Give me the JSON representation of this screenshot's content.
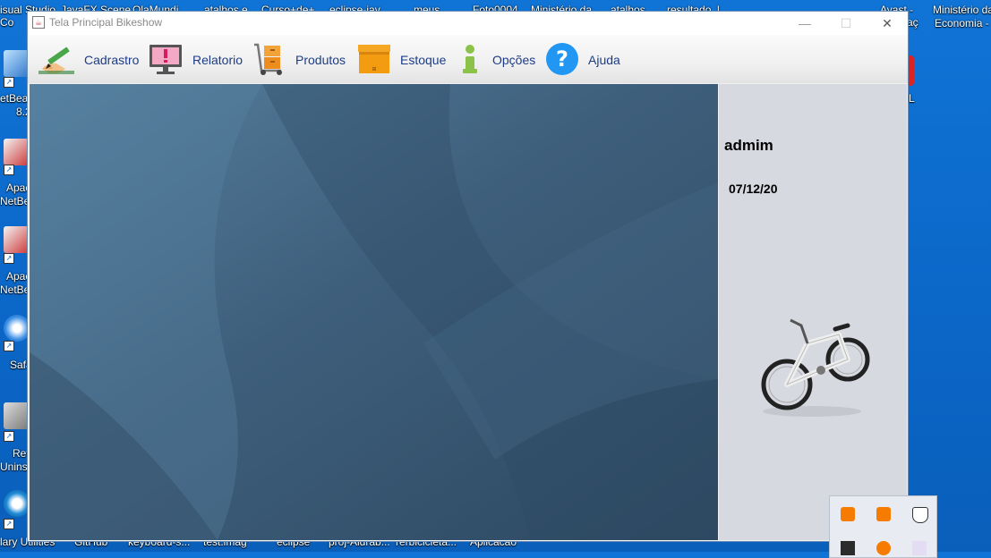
{
  "desktop": {
    "top_labels": [
      "isual Studio",
      "JavaFX Scene",
      "OlaMundi",
      "atalhos e",
      "Curso+de+",
      "eclipse-jav",
      "meus",
      "Foto0004",
      "Ministério da",
      "atalhos",
      "resultado_l",
      "Avast -",
      "Ministério da"
    ],
    "top_labels_line2": [
      "Co",
      "Economia -",
      "aç"
    ],
    "left_labels": [
      "etBea",
      "8.2",
      "Apac",
      "NetBea",
      "Apac",
      "NetBea",
      "Safa",
      "Rev",
      "Uninst"
    ],
    "bottom_labels": [
      "lary Utilities",
      "GitHub",
      "keyboard-s...",
      "test.imag",
      "eclipse",
      "proj-Aldrab...",
      "rerbicicleta...",
      "Aplicacao"
    ]
  },
  "window": {
    "title": "Tela Principal Bikeshow",
    "minimize_glyph": "—",
    "maximize_glyph": "☐",
    "close_glyph": "✕"
  },
  "toolbar": {
    "items": [
      {
        "label": "Cadrastro",
        "icon": "pencil-hand-icon"
      },
      {
        "label": "Relatorio",
        "icon": "monitor-alert-icon"
      },
      {
        "label": "Produtos",
        "icon": "hand-truck-boxes-icon"
      },
      {
        "label": "Estoque",
        "icon": "box-icon"
      },
      {
        "label": "Opções",
        "icon": "info-icon"
      },
      {
        "label": "Ajuda",
        "icon": "help-icon"
      }
    ]
  },
  "side_panel": {
    "user": "admim",
    "date": "07/12/20",
    "image": "bicycle-icon"
  },
  "colors": {
    "desktop_bg": "#0b67c8",
    "content_bg": "#3d5d79",
    "side_bg": "#d7d9e0",
    "toolbar_text": "#1c3c88"
  }
}
